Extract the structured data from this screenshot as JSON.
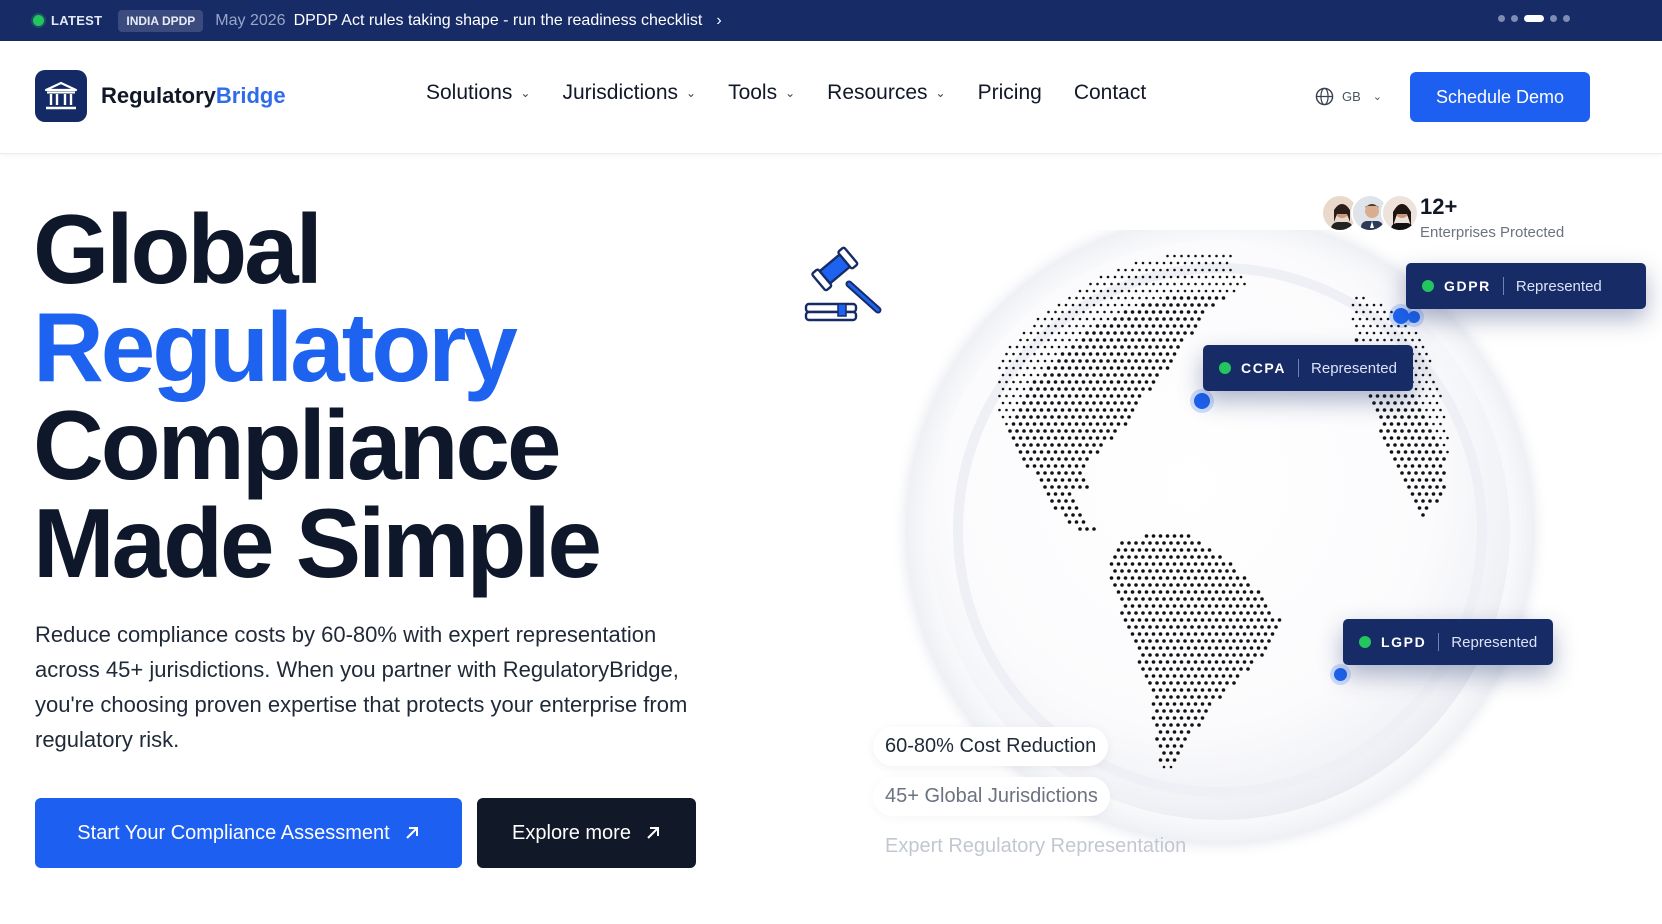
{
  "announcement": {
    "latest_label": "LATEST",
    "tag": "INDIA DPDP",
    "date": "May 2026",
    "text": "DPDP Act rules taking shape - run the readiness checklist",
    "arrow": "›",
    "pager_count": 5,
    "pager_active": 3
  },
  "header": {
    "logo": {
      "text_main": "Regulatory",
      "text_accent": "Bridge",
      "icon": "bank-building-icon"
    },
    "nav": [
      {
        "label": "Solutions",
        "has_dropdown": true
      },
      {
        "label": "Jurisdictions",
        "has_dropdown": true
      },
      {
        "label": "Tools",
        "has_dropdown": true
      },
      {
        "label": "Resources",
        "has_dropdown": true
      },
      {
        "label": "Pricing",
        "has_dropdown": false
      },
      {
        "label": "Contact",
        "has_dropdown": false
      }
    ],
    "language": {
      "icon": "globe-icon",
      "code": "GB"
    },
    "cta": "Schedule Demo"
  },
  "hero": {
    "title_line1": "Global",
    "title_line2": "Regulatory",
    "title_line3": "Compliance",
    "title_line4": "Made Simple",
    "description": "Reduce compliance costs by 60-80% with expert representation across 45+ jurisdictions. When you partner with RegulatoryBridge, you're choosing proven expertise that protects your enterprise from regulatory risk.",
    "primary_button": "Start Your Compliance Assessment",
    "secondary_button": "Explore more"
  },
  "visual": {
    "enterprises_count": "12+",
    "enterprises_label": "Enterprises Protected",
    "badges": [
      {
        "code": "GDPR",
        "status": "Represented"
      },
      {
        "code": "CCPA",
        "status": "Represented"
      },
      {
        "code": "LGPD",
        "status": "Represented"
      }
    ],
    "features": [
      "60-80% Cost Reduction",
      "45+ Global Jurisdictions",
      "Expert Regulatory Representation"
    ]
  },
  "colors": {
    "brand_navy": "#172b67",
    "brand_blue": "#1d5ff0",
    "status_green": "#22c55e",
    "text_dark": "#0f172a"
  }
}
